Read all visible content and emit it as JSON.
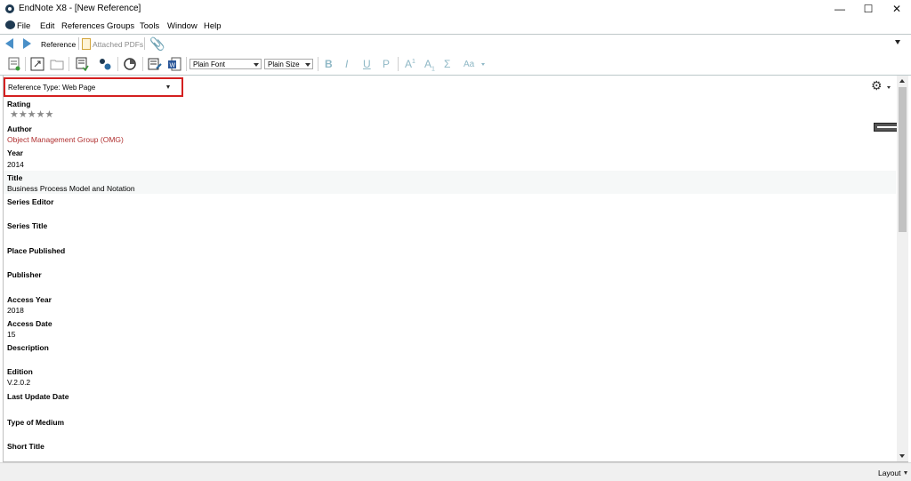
{
  "window": {
    "title": "EndNote X8 - [New Reference]",
    "minimize": "—",
    "maximize": "☐",
    "close": "✕"
  },
  "menu": {
    "items": [
      "File",
      "Edit",
      "References",
      "Groups",
      "Tools",
      "Window",
      "Help"
    ]
  },
  "tabs": {
    "reference": "Reference",
    "attached_pdfs": "Attached PDFs"
  },
  "toolbar": {
    "font": "Plain Font",
    "size": "Plain Size",
    "bold": "B",
    "italic": "I",
    "underline": "U",
    "plain": "P",
    "superscript": "A",
    "subscript": "A",
    "symbol": "Σ",
    "case": "Aa"
  },
  "reference_type": {
    "label": "Reference Type:",
    "value": "Web Page"
  },
  "fields": {
    "rating_label": "Rating",
    "rating_stars": "★★★★★",
    "rating_value": 0,
    "author_label": "Author",
    "author_value": "Object Management Group (OMG)",
    "year_label": "Year",
    "year_value": "2014",
    "title_label": "Title",
    "title_value": "Business Process Model and Notation",
    "series_editor_label": "Series Editor",
    "series_title_label": "Series Title",
    "place_published_label": "Place Published",
    "publisher_label": "Publisher",
    "access_year_label": "Access Year",
    "access_year_value": "2018",
    "access_date_label": "Access Date",
    "access_date_value": "15",
    "description_label": "Description",
    "edition_label": "Edition",
    "edition_value": "V.2.0.2",
    "last_update_label": "Last Update Date",
    "type_of_medium_label": "Type of Medium",
    "short_title_label": "Short Title"
  },
  "status": {
    "layout": "Layout"
  },
  "colors": {
    "highlight_border": "#d42020",
    "author_text": "#b03030",
    "nav_arrow": "#4a90c8"
  }
}
